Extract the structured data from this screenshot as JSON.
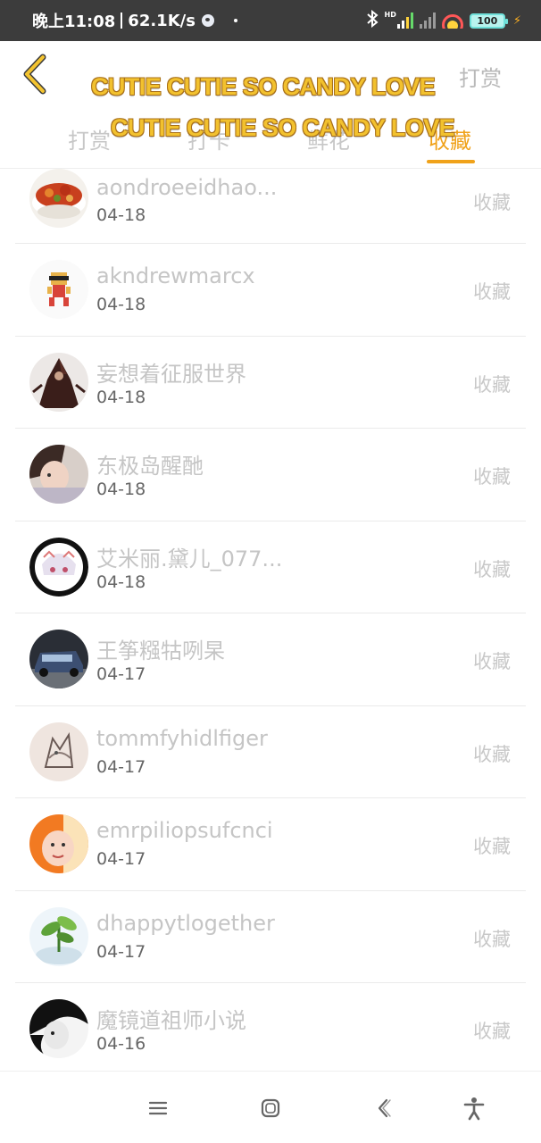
{
  "status_bar": {
    "time": "晚上11:08",
    "network_speed": "62.1K/s",
    "hd_label": "HD",
    "battery_level": "100",
    "icons": [
      "notification-bubble-icon",
      "bluetooth-icon",
      "signal-icon",
      "wifi-icon",
      "battery-icon",
      "charging-icon"
    ]
  },
  "header": {
    "back_icon": "chevron-left-icon",
    "reward_label": "打赏",
    "banner_line_1": "CUTIE CUTIE SO CANDY LOVE",
    "banner_line_2": "CUTIE CUTIE SO CANDY LOVE",
    "tabs": [
      {
        "label": "打赏"
      },
      {
        "label": "打卡"
      },
      {
        "label": "鲜花"
      },
      {
        "label": "收藏"
      }
    ],
    "active_tab": "收藏",
    "accent_color": "#f0a21a"
  },
  "list": {
    "items": [
      {
        "name": "aondroeeidhao...",
        "date": "04-18",
        "action": "收藏",
        "avatar": "food-bowl"
      },
      {
        "name": "akndrewmarcx",
        "date": "04-18",
        "action": "收藏",
        "avatar": "cartoon-character"
      },
      {
        "name": "妄想着征服世界",
        "date": "04-18",
        "action": "收藏",
        "avatar": "dark-figure"
      },
      {
        "name": "东极岛醒酏",
        "date": "04-18",
        "action": "收藏",
        "avatar": "portrait"
      },
      {
        "name": "艾米丽.黛儿_077...",
        "date": "04-18",
        "action": "收藏",
        "avatar": "anime-girl"
      },
      {
        "name": "王筝糨牯咧杲",
        "date": "04-17",
        "action": "收藏",
        "avatar": "car"
      },
      {
        "name": "tommfyhidlfiger",
        "date": "04-17",
        "action": "收藏",
        "avatar": "sketch"
      },
      {
        "name": "emrpiliopsufcnci",
        "date": "04-17",
        "action": "收藏",
        "avatar": "baby"
      },
      {
        "name": "dhappytlogether",
        "date": "04-17",
        "action": "收藏",
        "avatar": "plant"
      },
      {
        "name": "魔镜道祖师小说",
        "date": "04-16",
        "action": "收藏",
        "avatar": "bw-portrait"
      }
    ]
  },
  "nav_bar": {
    "buttons": [
      "menu-icon",
      "home-icon",
      "back-icon",
      "accessibility-icon"
    ]
  }
}
